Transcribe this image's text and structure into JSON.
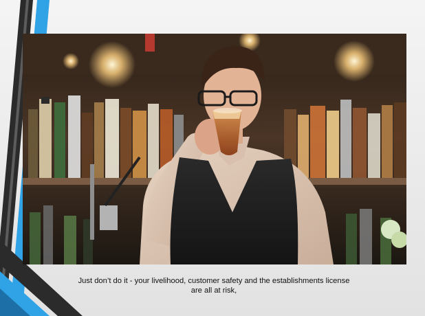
{
  "slide": {
    "caption_line1": "Just don’t do it - your livelihood, customer safety and the establishments license",
    "caption_line2": "are all at risk,"
  },
  "colors": {
    "accent_blue": "#2fa3e6",
    "accent_dark": "#2b2b2b",
    "background": "#ececec"
  },
  "photo": {
    "subject": "bartender-drinking-photo"
  }
}
